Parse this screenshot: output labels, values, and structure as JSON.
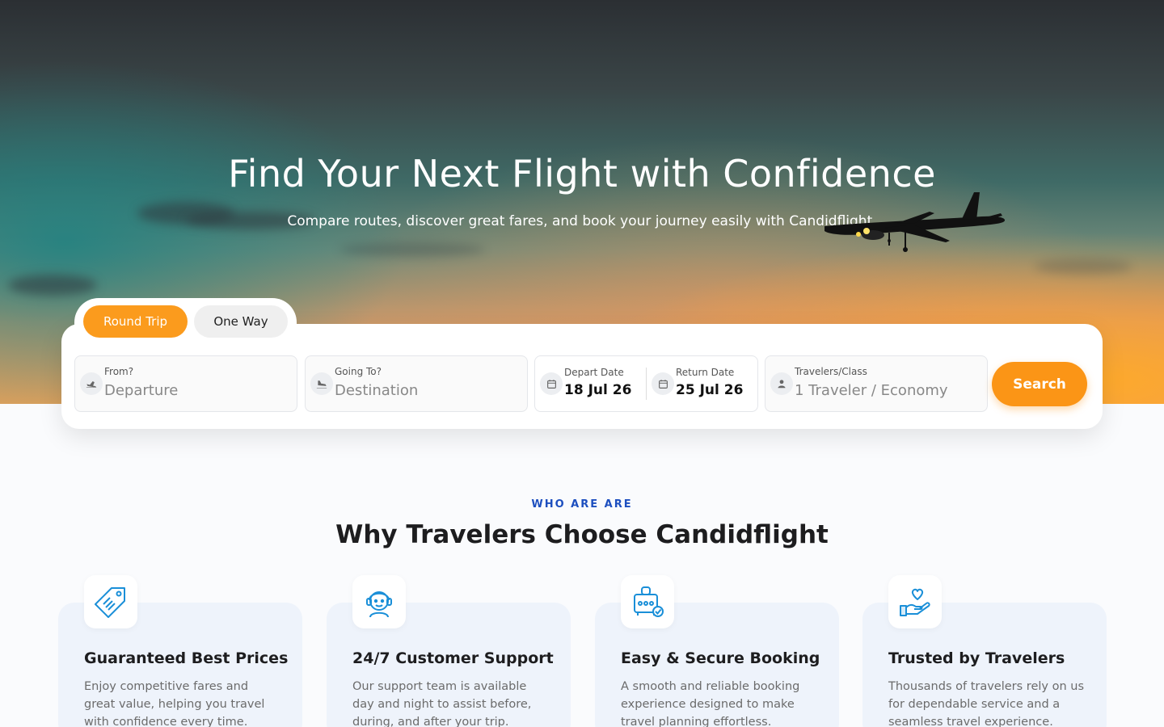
{
  "hero": {
    "title": "Find Your Next Flight with Confidence",
    "subtitle": "Compare routes, discover great fares, and book your journey easily with Candidflight."
  },
  "trip_tabs": {
    "round_trip": "Round Trip",
    "one_way": "One Way",
    "active": "round_trip"
  },
  "search": {
    "from": {
      "label": "From?",
      "placeholder": "Departure",
      "icon": "plane-takeoff-icon"
    },
    "to": {
      "label": "Going To?",
      "placeholder": "Destination",
      "icon": "plane-landing-icon"
    },
    "depart": {
      "label": "Depart Date",
      "value": "18 Jul 26",
      "icon": "calendar-icon"
    },
    "return": {
      "label": "Return Date",
      "value": "25 Jul 26",
      "icon": "calendar-icon"
    },
    "travelers": {
      "label": "Travelers/Class",
      "value": "1 Traveler / Economy",
      "icon": "user-icon"
    },
    "button": "Search"
  },
  "section": {
    "eyebrow": "WHO ARE ARE",
    "title": "Why Travelers Choose Candidflight"
  },
  "features": [
    {
      "title": "Guaranteed Best Prices",
      "desc": "Enjoy competitive fares and great value, helping you travel with confidence every time.",
      "icon": "price-tag-icon"
    },
    {
      "title": "24/7 Customer Support",
      "desc": "Our support team is available day and night to assist before, during, and after your trip.",
      "icon": "support-agent-icon"
    },
    {
      "title": "Easy & Secure Booking",
      "desc": "A smooth and reliable booking experience designed to make travel planning effortless.",
      "icon": "secure-luggage-icon"
    },
    {
      "title": "Trusted by Travelers",
      "desc": "Thousands of travelers rely on us for dependable service and a seamless travel experience.",
      "icon": "heart-hand-icon"
    }
  ],
  "colors": {
    "accent": "#fb9516",
    "eyebrow": "#1d4fbf",
    "icon_blue": "#1a8fd8"
  }
}
